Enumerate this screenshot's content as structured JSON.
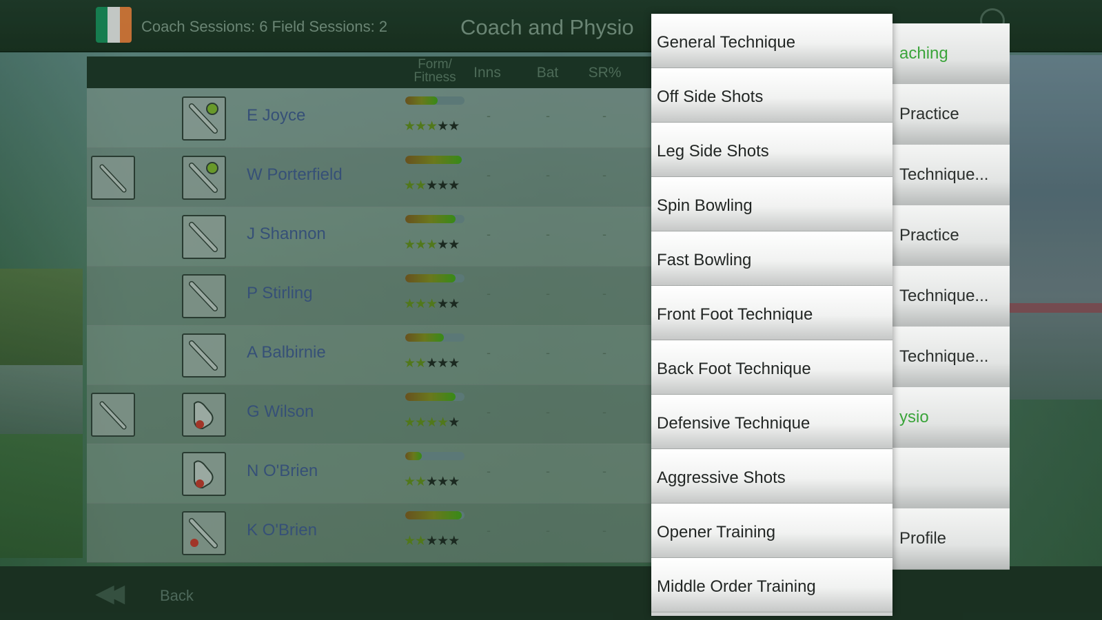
{
  "header": {
    "sessions_text": "Coach Sessions: 6  Field Sessions: 2",
    "title": "Coach and Physio",
    "flag_colors": [
      "#169b62",
      "#ffffff",
      "#ff883e"
    ]
  },
  "table": {
    "columns": [
      "Form/\nFitness",
      "Inns",
      "Bat",
      "SR%"
    ],
    "rows": [
      {
        "name": "E Joyce",
        "form": 0.55,
        "stars_on": 3,
        "stars_total": 5,
        "inns": "-",
        "bat": "-",
        "sr": "-"
      },
      {
        "name": "W Porterfield",
        "form": 0.95,
        "stars_on": 2,
        "stars_total": 5,
        "inns": "-",
        "bat": "-",
        "sr": "-"
      },
      {
        "name": "J Shannon",
        "form": 0.85,
        "stars_on": 3,
        "stars_total": 5,
        "inns": "-",
        "bat": "-",
        "sr": "-"
      },
      {
        "name": "P Stirling",
        "form": 0.85,
        "stars_on": 3,
        "stars_total": 5,
        "inns": "-",
        "bat": "-",
        "sr": "-"
      },
      {
        "name": "A Balbirnie",
        "form": 0.65,
        "stars_on": 2,
        "stars_total": 5,
        "inns": "-",
        "bat": "-",
        "sr": "-"
      },
      {
        "name": "G Wilson",
        "form": 0.85,
        "stars_on": 4,
        "stars_total": 5,
        "inns": "-",
        "bat": "-",
        "sr": "-"
      },
      {
        "name": "N O'Brien",
        "form": 0.28,
        "stars_on": 2,
        "stars_total": 5,
        "inns": "-",
        "bat": "-",
        "sr": "-"
      },
      {
        "name": "K O'Brien",
        "form": 0.95,
        "stars_on": 2,
        "stars_total": 5,
        "inns": "-",
        "bat": "-",
        "sr": "-"
      }
    ]
  },
  "back_menu": {
    "items": [
      "aching",
      "Practice",
      "Technique...",
      "Practice",
      "Technique...",
      "Technique...",
      "ysio",
      "",
      "Profile"
    ]
  },
  "dropdown": {
    "items": [
      "General Technique",
      "Off Side Shots",
      "Leg Side Shots",
      "Spin Bowling",
      "Fast Bowling",
      "Front Foot Technique",
      "Back Foot Technique",
      "Defensive Technique",
      "Aggressive Shots",
      "Opener Training",
      "Middle Order Training"
    ]
  },
  "footer": {
    "back_label": "Back"
  }
}
